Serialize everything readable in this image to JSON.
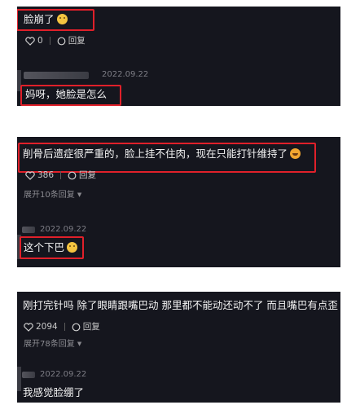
{
  "panels": [
    {
      "comment1": {
        "text": "脸崩了",
        "emoji": "grimace-emoji",
        "likes": "0",
        "reply_label": "回复"
      },
      "comment2": {
        "date": "2022.09.22",
        "text": "妈呀，她脸是怎么"
      }
    },
    {
      "comment1": {
        "text": "削骨后遗症很严重的，脸上挂不住肉，现在只能打针维持了",
        "emoji": "laughing-emoji",
        "likes": "386",
        "reply_label": "回复",
        "expand": "展开10条回复"
      },
      "comment2": {
        "date": "2022.09.22",
        "text": "这个下巴",
        "emoji": "grimace-emoji"
      }
    },
    {
      "comment1": {
        "text": "刚打完针吗 除了眼睛跟嘴巴动 那里都不能动还动不了 而且嘴巴有点歪",
        "emoji": "laughing-emoji",
        "likes": "2094",
        "reply_label": "回复",
        "expand": "展开78条回复"
      },
      "comment2": {
        "date": "2022.09.22",
        "text": "我感觉脸绷了"
      }
    }
  ],
  "colors": {
    "background": "#15161e",
    "highlight": "#e0202a",
    "text": "#f3f3f3"
  }
}
